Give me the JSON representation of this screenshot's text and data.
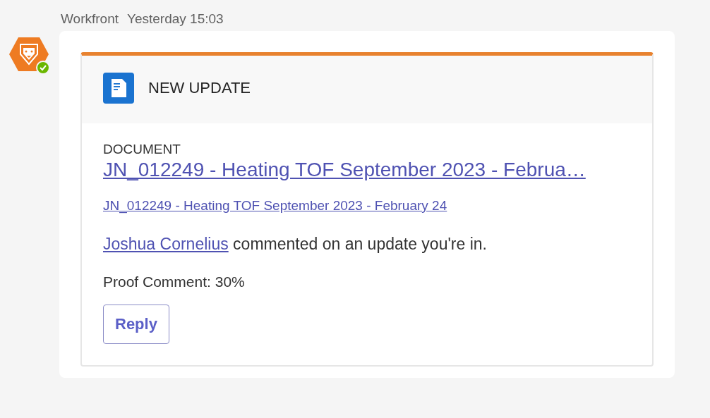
{
  "message": {
    "sender": "Workfront",
    "time": "Yesterday 15:03",
    "online": true
  },
  "card": {
    "header": "NEW UPDATE",
    "type_label": "DOCUMENT",
    "title_link": "JN_012249 - Heating TOF September 2023 - Februa…",
    "sub_link": "JN_012249 - Heating TOF September 2023 - February 24",
    "activity": {
      "person": "Joshua Cornelius",
      "text": "commented on an update you're in."
    },
    "comment": "Proof Comment: 30%",
    "buttons": [
      "Reply"
    ]
  }
}
